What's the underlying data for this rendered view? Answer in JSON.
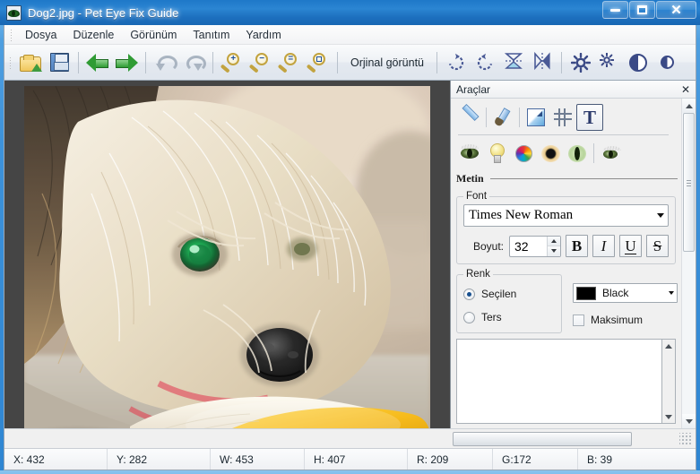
{
  "window": {
    "title": "Dog2.jpg - Pet Eye Fix Guide",
    "app_icon": "green-eye-icon",
    "minimize_label": "–",
    "maximize_label": "□",
    "close_label": "✕"
  },
  "menu": {
    "items": [
      {
        "label": "Dosya"
      },
      {
        "label": "Düzenle"
      },
      {
        "label": "Görünüm"
      },
      {
        "label": "Tanıtım"
      },
      {
        "label": "Yardım"
      }
    ]
  },
  "toolbar": {
    "original_label": "Orjinal görüntü",
    "buttons": [
      {
        "name": "open-icon",
        "title": "Aç"
      },
      {
        "name": "save-icon",
        "title": "Kaydet"
      },
      {
        "name": "back-arrow-icon",
        "title": "Geri"
      },
      {
        "name": "forward-arrow-icon",
        "title": "İleri"
      },
      {
        "name": "undo-icon",
        "title": "Geri al"
      },
      {
        "name": "redo-icon",
        "title": "Yinele"
      },
      {
        "name": "zoom-in-icon",
        "title": "Yakınlaştır"
      },
      {
        "name": "zoom-out-icon",
        "title": "Uzaklaştır"
      },
      {
        "name": "zoom-fit-icon",
        "title": "Sığdır"
      },
      {
        "name": "zoom-actual-icon",
        "title": "Gerçek boyut"
      },
      {
        "name": "rotate-cw-icon",
        "title": "Sağa döndür"
      },
      {
        "name": "rotate-ccw-icon",
        "title": "Sola döndür"
      },
      {
        "name": "flip-vertical-icon",
        "title": "Dikey çevir"
      },
      {
        "name": "flip-horizontal-icon",
        "title": "Yatay çevir"
      },
      {
        "name": "brightness-icon",
        "title": "Parlaklık"
      },
      {
        "name": "brightness-small-icon",
        "title": "Parlaklık"
      },
      {
        "name": "contrast-icon",
        "title": "Kontrast"
      },
      {
        "name": "contrast-small-icon",
        "title": "Kontrast"
      }
    ]
  },
  "tools_panel": {
    "title": "Araçlar",
    "close_label": "✕",
    "tool_icons": [
      {
        "name": "line-tool-icon",
        "label": "Çizgi",
        "selected": false
      },
      {
        "name": "brush-tool-icon",
        "label": "Fırça",
        "selected": false
      },
      {
        "name": "gradient-tool-icon",
        "label": "Gradyan",
        "selected": false
      },
      {
        "name": "crop-tool-icon",
        "label": "Kırp",
        "selected": false
      },
      {
        "name": "text-tool-icon",
        "label": "T",
        "selected": true
      }
    ],
    "eye_icons": [
      {
        "name": "eye-fix-icon",
        "label": "Göz düzelt"
      },
      {
        "name": "lightbulb-icon",
        "label": "Parlaklık"
      },
      {
        "name": "color-wheel-icon",
        "label": "Renk"
      },
      {
        "name": "pupil-icon",
        "label": "Gözbebeği"
      },
      {
        "name": "cat-eye-icon",
        "label": "Kedi gözü"
      },
      {
        "name": "eye-small-icon",
        "label": "Göz"
      }
    ],
    "section_title": "Metin",
    "font_group": {
      "legend": "Font",
      "font_family": "Times New Roman",
      "size_label": "Boyut:",
      "size_value": "32",
      "style_buttons": [
        {
          "name": "bold-button",
          "label": "B"
        },
        {
          "name": "italic-button",
          "label": "I"
        },
        {
          "name": "underline-button",
          "label": "U"
        },
        {
          "name": "strikethrough-button",
          "label": "S"
        }
      ]
    },
    "color_group": {
      "legend": "Renk",
      "radio_selected": "Seçilen",
      "radio_inverse": "Ters",
      "selected_radio": "Seçilen",
      "color_value": "Black",
      "color_hex": "#000000",
      "checkbox_label": "Maksimum",
      "checkbox_checked": false
    },
    "text_input_value": "",
    "text_input_placeholder": ""
  },
  "statusbar": {
    "cells": [
      {
        "name": "status-x",
        "label": "X: 432"
      },
      {
        "name": "status-y",
        "label": "Y: 282"
      },
      {
        "name": "status-w",
        "label": "W: 453"
      },
      {
        "name": "status-h",
        "label": "H: 407"
      },
      {
        "name": "status-r",
        "label": "R: 209"
      },
      {
        "name": "status-g",
        "label": "G:172"
      },
      {
        "name": "status-b",
        "label": "B: 39"
      }
    ]
  },
  "canvas": {
    "image_name": "Dog2.jpg",
    "image_width": "453",
    "image_height": "407",
    "background_color": "#454545"
  }
}
